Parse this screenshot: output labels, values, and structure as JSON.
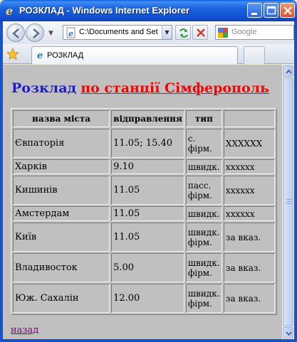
{
  "window": {
    "title": "РОЗКЛАД - Windows Internet Explorer"
  },
  "navbar": {
    "address_value": "C:\\Documents and Set",
    "search_placeholder": "Google"
  },
  "tabs": [
    {
      "label": "РОЗКЛАД"
    }
  ],
  "page": {
    "heading_prefix": "Розклад",
    "heading_link": "по станції Сімферополь",
    "back_link": "назад",
    "table": {
      "headers": [
        "назва міста",
        "відправлення",
        "тип",
        ""
      ],
      "rows": [
        {
          "city": "Євпаторія",
          "departure": "11.05; 15.40",
          "type_line1": "с.",
          "type_line2": "фірм.",
          "note": "XXXXXX"
        },
        {
          "city": "Харків",
          "departure": "9.10",
          "type_line1": "швидк.",
          "type_line2": "",
          "note": "xxxxxx"
        },
        {
          "city": "Кишинів",
          "departure": "11.05",
          "type_line1": "пасс.",
          "type_line2": "фірм.",
          "note": "xxxxxx"
        },
        {
          "city": "Амстердам",
          "departure": "11.05",
          "type_line1": "швидк.",
          "type_line2": "",
          "note": "xxxxxx"
        },
        {
          "city": "Київ",
          "departure": "11.05",
          "type_line1": "швидк.",
          "type_line2": "фірм.",
          "note": "за вказ."
        },
        {
          "city": "Владивосток",
          "departure": "5.00",
          "type_line1": "швидк.",
          "type_line2": "фірм.",
          "note": "за вказ."
        },
        {
          "city": "Юж. Сахалін",
          "departure": "12.00",
          "type_line1": "швидк.",
          "type_line2": "фірм.",
          "note": "за вказ."
        }
      ]
    }
  },
  "colors": {
    "page_background": "#c0c0c0",
    "heading_blue": "#1a1ad8",
    "heading_link_red": "#ff0000",
    "visited_link": "#800080",
    "titlebar_blue": "#1b62e1"
  },
  "icons": {
    "app": "ie-logo-icon",
    "back": "back-arrow-icon",
    "forward": "forward-arrow-icon",
    "refresh": "refresh-icon",
    "stop": "stop-icon",
    "search_provider": "google-icon",
    "favorites": "favorites-star-icon"
  }
}
